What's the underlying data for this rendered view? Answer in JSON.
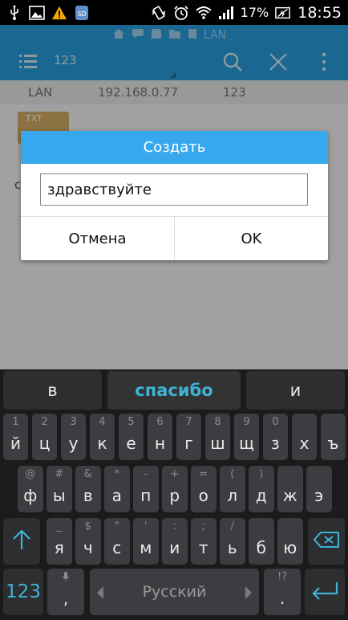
{
  "status": {
    "battery": "17%",
    "time": "18:55",
    "left_icons": [
      "usb-icon",
      "image-icon",
      "warning-icon",
      "sd-card-icon"
    ],
    "right_icons": [
      "vibrate-icon",
      "alarm-icon",
      "wifi-icon",
      "signal-icon",
      "battery-icon"
    ]
  },
  "app": {
    "path_label": "LAN",
    "toolbar_title": "123",
    "info": {
      "name": "LAN",
      "ip": "192.168.0.77",
      "share": "123"
    },
    "file_tag": "TXT",
    "file_partial": "с"
  },
  "dialog": {
    "title": "Создать",
    "input_value": "здравствуйте",
    "cancel_label": "Отмена",
    "ok_label": "OK"
  },
  "keyboard": {
    "suggestions": [
      "в",
      "спасибо",
      "и"
    ],
    "row1": [
      {
        "main": "й",
        "hint": "1"
      },
      {
        "main": "ц",
        "hint": "2"
      },
      {
        "main": "у",
        "hint": "3"
      },
      {
        "main": "к",
        "hint": "4"
      },
      {
        "main": "е",
        "hint": "5"
      },
      {
        "main": "н",
        "hint": "6"
      },
      {
        "main": "г",
        "hint": "7"
      },
      {
        "main": "ш",
        "hint": "8"
      },
      {
        "main": "щ",
        "hint": "9"
      },
      {
        "main": "з",
        "hint": "0"
      },
      {
        "main": "х",
        "hint": ""
      },
      {
        "main": "ъ",
        "hint": ""
      }
    ],
    "row2": [
      {
        "main": "ф",
        "hint": "@"
      },
      {
        "main": "ы",
        "hint": "#"
      },
      {
        "main": "в",
        "hint": "&"
      },
      {
        "main": "а",
        "hint": "*"
      },
      {
        "main": "п",
        "hint": "-"
      },
      {
        "main": "р",
        "hint": "+"
      },
      {
        "main": "о",
        "hint": "="
      },
      {
        "main": "л",
        "hint": "("
      },
      {
        "main": "д",
        "hint": ")"
      },
      {
        "main": "ж",
        "hint": ""
      },
      {
        "main": "э",
        "hint": ""
      }
    ],
    "row3": [
      {
        "main": "я",
        "hint": "_"
      },
      {
        "main": "ч",
        "hint": "$"
      },
      {
        "main": "с",
        "hint": "\""
      },
      {
        "main": "м",
        "hint": "'"
      },
      {
        "main": "и",
        "hint": ":"
      },
      {
        "main": "т",
        "hint": ";"
      },
      {
        "main": "ь",
        "hint": "/"
      },
      {
        "main": "б",
        "hint": ""
      },
      {
        "main": "ю",
        "hint": ""
      }
    ],
    "numbers_label": "123",
    "comma": ",",
    "space_label": "Русский",
    "period": ".",
    "period_hint": "!?",
    "accent_color": "#3fb3d6"
  }
}
